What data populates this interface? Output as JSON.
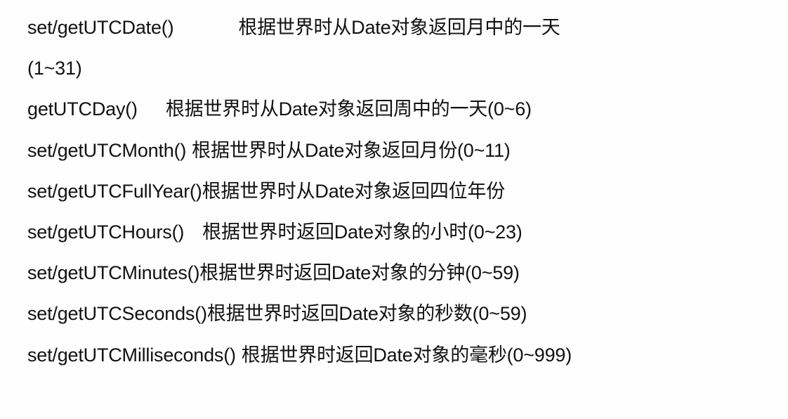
{
  "lines": [
    {
      "method": "set/getUTCDate()",
      "desc": "根据世界时从Date对象返回月中的一天"
    },
    {
      "method": "",
      "desc": "(1~31)"
    },
    {
      "method": "getUTCDay()",
      "desc": "根据世界时从Date对象返回周中的一天(0~6)"
    },
    {
      "method": "set/getUTCMonth()",
      "desc": "根据世界时从Date对象返回月份(0~11)"
    },
    {
      "method": "set/getUTCFullYear()",
      "desc": "根据世界时从Date对象返回四位年份"
    },
    {
      "method": "set/getUTCHours()",
      "desc": "根据世界时返回Date对象的小时(0~23)"
    },
    {
      "method": "set/getUTCMinutes()",
      "desc": "根据世界时返回Date对象的分钟(0~59)"
    },
    {
      "method": "set/getUTCSeconds()",
      "desc": "根据世界时返回Date对象的秒数(0~59)"
    },
    {
      "method": "set/getUTCMilliseconds()",
      "desc": "根据世界时返回Date对象的毫秒(0~999)"
    }
  ]
}
